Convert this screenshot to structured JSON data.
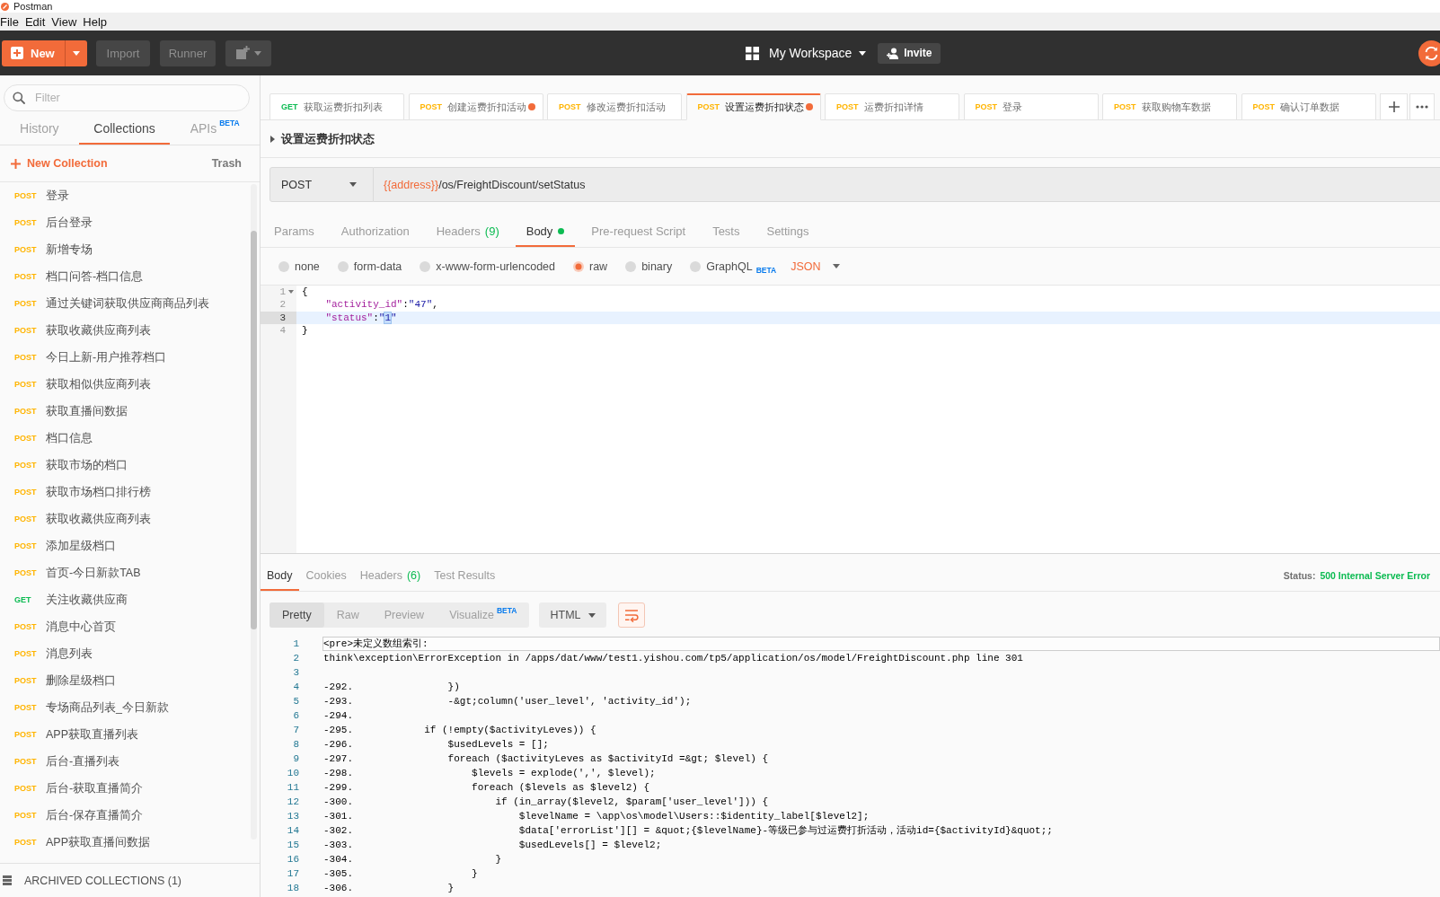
{
  "window": {
    "title": "Postman"
  },
  "menu": [
    "File",
    "Edit",
    "View",
    "Help"
  ],
  "header": {
    "new_button": "New",
    "import_button": "Import",
    "runner_button": "Runner",
    "workspace": "My Workspace",
    "invite_button": "Invite"
  },
  "sidebar": {
    "filter": {
      "placeholder": "Filter"
    },
    "tabs": [
      {
        "label": "History",
        "selected": false
      },
      {
        "label": "Collections",
        "selected": true
      },
      {
        "label": "APIs",
        "badge": "BETA",
        "selected": false
      }
    ],
    "new_collection": "New Collection",
    "trash": "Trash",
    "items": [
      {
        "method": "POST",
        "color": "#ffb400",
        "name": "登录"
      },
      {
        "method": "POST",
        "color": "#ffb400",
        "name": "后台登录"
      },
      {
        "method": "POST",
        "color": "#ffb400",
        "name": "新增专场"
      },
      {
        "method": "POST",
        "color": "#ffb400",
        "name": "档口问答-档口信息"
      },
      {
        "method": "POST",
        "color": "#ffb400",
        "name": "通过关键词获取供应商商品列表"
      },
      {
        "method": "POST",
        "color": "#ffb400",
        "name": "获取收藏供应商列表"
      },
      {
        "method": "POST",
        "color": "#ffb400",
        "name": "今日上新-用户推荐档口"
      },
      {
        "method": "POST",
        "color": "#ffb400",
        "name": "获取相似供应商列表"
      },
      {
        "method": "POST",
        "color": "#ffb400",
        "name": "获取直播间数据"
      },
      {
        "method": "POST",
        "color": "#ffb400",
        "name": "档口信息"
      },
      {
        "method": "POST",
        "color": "#ffb400",
        "name": "获取市场的档口"
      },
      {
        "method": "POST",
        "color": "#ffb400",
        "name": "获取市场档口排行榜"
      },
      {
        "method": "POST",
        "color": "#ffb400",
        "name": "获取收藏供应商列表"
      },
      {
        "method": "POST",
        "color": "#ffb400",
        "name": "添加星级档口"
      },
      {
        "method": "POST",
        "color": "#ffb400",
        "name": "首页-今日新款TAB"
      },
      {
        "method": "GET",
        "color": "#0cbb52",
        "name": "关注收藏供应商"
      },
      {
        "method": "POST",
        "color": "#ffb400",
        "name": "消息中心首页"
      },
      {
        "method": "POST",
        "color": "#ffb400",
        "name": "消息列表"
      },
      {
        "method": "POST",
        "color": "#ffb400",
        "name": "删除星级档口"
      },
      {
        "method": "POST",
        "color": "#ffb400",
        "name": "专场商品列表_今日新款"
      },
      {
        "method": "POST",
        "color": "#ffb400",
        "name": "APP获取直播列表"
      },
      {
        "method": "POST",
        "color": "#ffb400",
        "name": "后台-直播列表"
      },
      {
        "method": "POST",
        "color": "#ffb400",
        "name": "后台-获取直播简介"
      },
      {
        "method": "POST",
        "color": "#ffb400",
        "name": "后台-保存直播简介"
      },
      {
        "method": "POST",
        "color": "#ffb400",
        "name": "APP获取直播间数据"
      }
    ],
    "archived": "ARCHIVED COLLECTIONS (1)"
  },
  "request_tabs": [
    {
      "method": "GET",
      "color": "#0cbb52",
      "label": "获取运费折扣列表",
      "selected": false,
      "unsaved": false
    },
    {
      "method": "POST",
      "color": "#ffb400",
      "label": "创建运费折扣活动",
      "selected": false,
      "unsaved": true
    },
    {
      "method": "POST",
      "color": "#ffb400",
      "label": "修改运费折扣活动",
      "selected": false,
      "unsaved": false
    },
    {
      "method": "POST",
      "color": "#ffb400",
      "label": "设置运费折扣状态",
      "selected": true,
      "unsaved": true
    },
    {
      "method": "POST",
      "color": "#ffb400",
      "label": "运费折扣详情",
      "selected": false,
      "unsaved": false
    },
    {
      "method": "POST",
      "color": "#ffb400",
      "label": "登录",
      "selected": false,
      "unsaved": false
    },
    {
      "method": "POST",
      "color": "#ffb400",
      "label": "获取购物车数据",
      "selected": false,
      "unsaved": false
    },
    {
      "method": "POST",
      "color": "#ffb400",
      "label": "确认订单数据",
      "selected": false,
      "unsaved": false
    }
  ],
  "request": {
    "name": "设置运费折扣状态",
    "method": "POST",
    "url": {
      "variable": "{{address}}",
      "path": "/os/FreightDiscount/setStatus"
    },
    "tabs": [
      {
        "label": "Params",
        "selected": false,
        "dot": false
      },
      {
        "label": "Authorization",
        "selected": false,
        "dot": false
      },
      {
        "label": "Headers",
        "count": "(9)",
        "selected": false,
        "dot": false
      },
      {
        "label": "Body",
        "selected": true,
        "dot": true
      },
      {
        "label": "Pre-request Script",
        "selected": false,
        "dot": false
      },
      {
        "label": "Tests",
        "selected": false,
        "dot": false
      },
      {
        "label": "Settings",
        "selected": false,
        "dot": false
      }
    ],
    "body_modes": [
      {
        "label": "none",
        "selected": false
      },
      {
        "label": "form-data",
        "selected": false
      },
      {
        "label": "x-www-form-urlencoded",
        "selected": false
      },
      {
        "label": "raw",
        "selected": true
      },
      {
        "label": "binary",
        "selected": false
      },
      {
        "label": "GraphQL",
        "badge": "BETA",
        "selected": false
      }
    ],
    "language": "JSON",
    "editor": {
      "lines": [
        {
          "number": "1",
          "fold": true,
          "highlighted": false,
          "tokens": [
            {
              "kind": "punct",
              "text": "{"
            }
          ]
        },
        {
          "number": "2",
          "fold": false,
          "highlighted": false,
          "tokens": [
            {
              "kind": "key",
              "text": "    \"activity_id\""
            },
            {
              "kind": "punct",
              "text": ":"
            },
            {
              "kind": "string",
              "text": "\"47\""
            },
            {
              "kind": "punct",
              "text": ","
            }
          ]
        },
        {
          "number": "3",
          "fold": false,
          "highlighted": true,
          "tokens": [
            {
              "kind": "key",
              "text": "    \"status\""
            },
            {
              "kind": "punct",
              "text": ":"
            },
            {
              "kind": "string",
              "text": "\""
            },
            {
              "kind": "selection",
              "text": "1"
            },
            {
              "kind": "string",
              "text": "\""
            }
          ]
        },
        {
          "number": "4",
          "fold": false,
          "highlighted": false,
          "tokens": [
            {
              "kind": "punct",
              "text": "}"
            }
          ]
        }
      ]
    }
  },
  "response": {
    "tabs": [
      {
        "label": "Body",
        "selected": true
      },
      {
        "label": "Cookies",
        "selected": false
      },
      {
        "label": "Headers",
        "count": "(6)",
        "selected": false
      },
      {
        "label": "Test Results",
        "selected": false
      }
    ],
    "status_label": "Status:",
    "status": "500 Internal Server Error",
    "views": [
      {
        "label": "Pretty",
        "selected": true
      },
      {
        "label": "Raw",
        "selected": false
      },
      {
        "label": "Preview",
        "selected": false
      },
      {
        "label": "Visualize",
        "badge": "BETA",
        "selected": false
      }
    ],
    "format": "HTML",
    "wrap_lines": true,
    "lines": [
      {
        "number": "1",
        "highlighted": true,
        "text": "<pre>未定义数组索引:"
      },
      {
        "number": "2",
        "highlighted": false,
        "text": "think\\exception\\ErrorException in /apps/dat/www/test1.yishou.com/tp5/application/os/model/FreightDiscount.php line 301"
      },
      {
        "number": "3",
        "highlighted": false
      },
      {
        "number": "4",
        "highlighted": false,
        "text": "-292.                })"
      },
      {
        "number": "5",
        "highlighted": false,
        "text": "-293.                -&gt;column('user_level', 'activity_id');"
      },
      {
        "number": "6",
        "highlighted": false,
        "text": "-294."
      },
      {
        "number": "7",
        "highlighted": false,
        "text": "-295.            if (!empty($activityLeves)) {"
      },
      {
        "number": "8",
        "highlighted": false,
        "text": "-296.                $usedLevels = [];"
      },
      {
        "number": "9",
        "highlighted": false,
        "text": "-297.                foreach ($activityLeves as $activityId =&gt; $level) {"
      },
      {
        "number": "10",
        "highlighted": false,
        "text": "-298.                    $levels = explode(',', $level);"
      },
      {
        "number": "11",
        "highlighted": false,
        "text": "-299.                    foreach ($levels as $level2) {"
      },
      {
        "number": "12",
        "highlighted": false,
        "text": "-300.                        if (in_array($level2, $param['user_level'])) {"
      },
      {
        "number": "13",
        "highlighted": false,
        "text": "-301.                            $levelName = \\app\\os\\model\\Users::$identity_label[$level2];"
      },
      {
        "number": "14",
        "highlighted": false,
        "text": "-302.                            $data['errorList'][] = &quot;{$levelName}-等级已参与过运费打折活动，活动id={$activityId}&quot;;"
      },
      {
        "number": "15",
        "highlighted": false,
        "text": "-303.                            $usedLevels[] = $level2;"
      },
      {
        "number": "16",
        "highlighted": false,
        "text": "-304.                        }"
      },
      {
        "number": "17",
        "highlighted": false,
        "text": "-305.                    }"
      },
      {
        "number": "18",
        "highlighted": false,
        "text": "-306.                }"
      }
    ]
  }
}
